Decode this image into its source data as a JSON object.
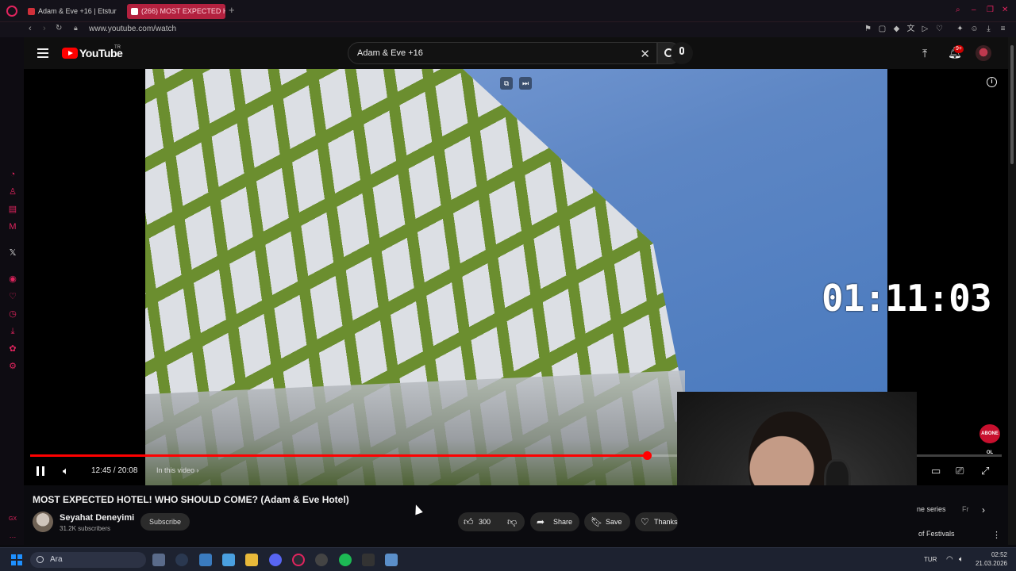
{
  "browser": {
    "tabs": [
      {
        "label": "Adam & Eve +16 | Etstur"
      },
      {
        "label": "(266) MOST EXPECTED H"
      }
    ],
    "new_tab": "+",
    "url": "www.youtube.com/watch"
  },
  "youtube": {
    "logo_text": "YouTube",
    "region": "TR",
    "search": {
      "value": "Adam & Eve +16"
    },
    "notifications_badge": "9+"
  },
  "player": {
    "overlay_timer": "01:11:03",
    "time_display": "12:45 / 20:08",
    "in_this_video": "In this video",
    "progress_fraction": 0.635,
    "abone_badge": "ABONE OL"
  },
  "video": {
    "title": "MOST EXPECTED HOTEL! WHO SHOULD COME? (Adam & Eve Hotel)",
    "channel_name": "Seyahat Deneyimi",
    "subscribers": "31.2K subscribers",
    "subscribe_label": "Subscribe",
    "likes": "300",
    "share_label": "Share",
    "save_label": "Save",
    "thanks_label": "Thanks"
  },
  "sidebar_right": {
    "chip_1": "ne series",
    "chip_2": "Fr",
    "festival_text": "of Festivals"
  },
  "taskbar": {
    "search_placeholder": "Ara",
    "language": "TUR",
    "time": "02:52",
    "date": "21.03.2026"
  },
  "colors": {
    "accent": "#e0245e",
    "yt_red": "#ff0000"
  }
}
